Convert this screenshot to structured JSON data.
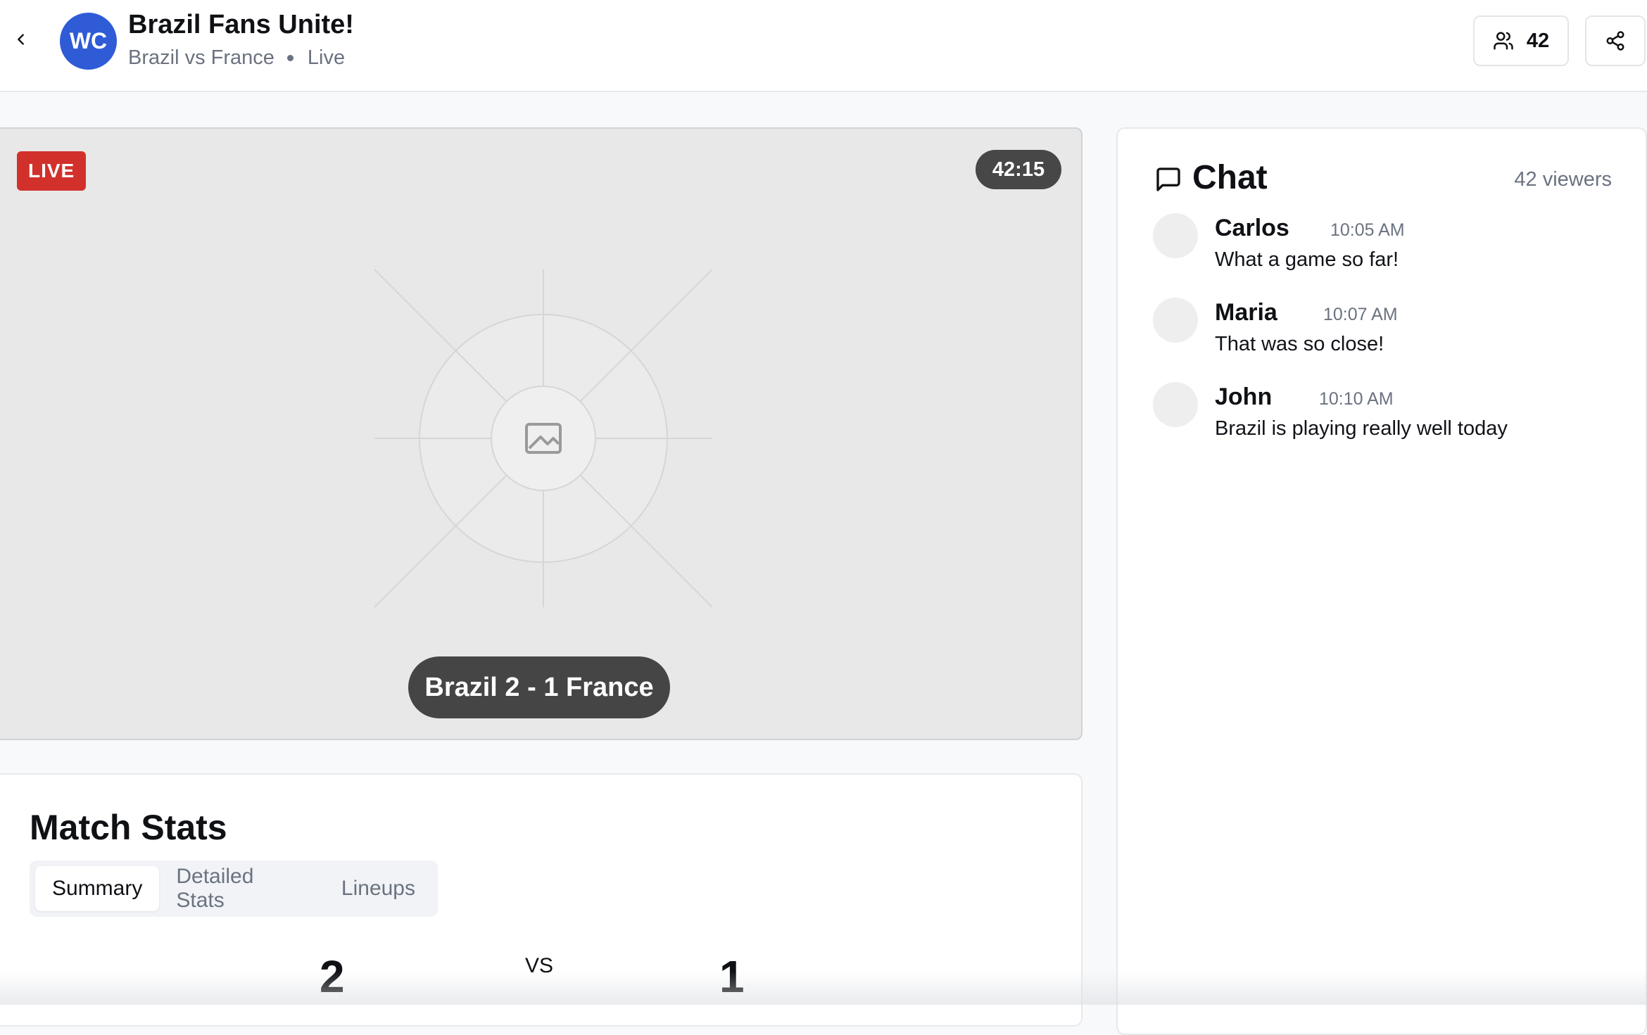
{
  "header": {
    "group_initials": "WC",
    "group_title": "Brazil Fans Unite!",
    "match": "Brazil vs France",
    "status": "Live",
    "viewer_count": "42"
  },
  "video": {
    "live_label": "LIVE",
    "timer": "42:15",
    "score_text": "Brazil 2 - 1 France"
  },
  "stats": {
    "title": "Match Stats",
    "tabs": [
      {
        "label": "Summary",
        "active": true
      },
      {
        "label": "Detailed Stats",
        "active": false
      },
      {
        "label": "Lineups",
        "active": false
      }
    ],
    "home_score": "2",
    "vs_label": "VS",
    "away_score": "1"
  },
  "chat": {
    "title": "Chat",
    "viewers": "42 viewers",
    "messages": [
      {
        "name": "Carlos",
        "time": "10:05 AM",
        "text": "What a game so far!"
      },
      {
        "name": "Maria",
        "time": "10:07 AM",
        "text": "That was so close!"
      },
      {
        "name": "John",
        "time": "10:10 AM",
        "text": "Brazil is playing really well today"
      }
    ]
  },
  "colors": {
    "accent": "#2f5bd6",
    "live": "#d2312b",
    "overlay": "#454545"
  },
  "icons": [
    "chevron-left-icon",
    "users-icon",
    "share-icon",
    "image-placeholder-icon",
    "message-square-icon"
  ]
}
